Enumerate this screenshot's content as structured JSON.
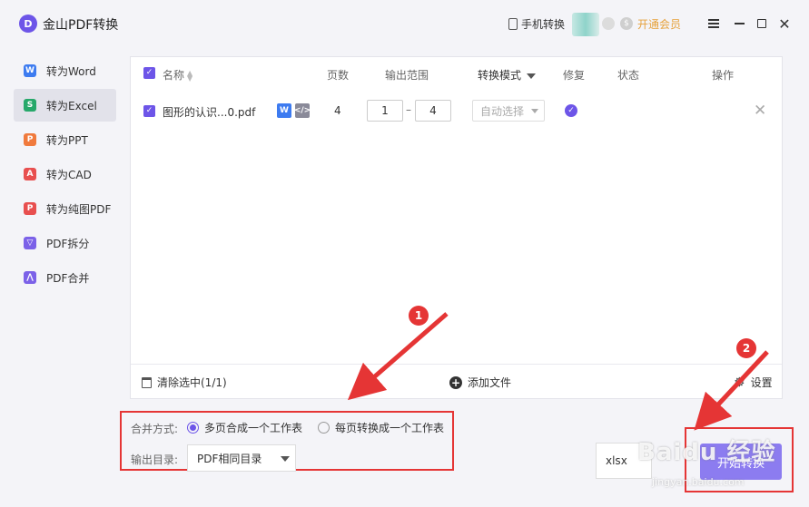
{
  "app": {
    "title": "金山PDF转换",
    "logo_glyph": "D",
    "phone_convert": "手机转换",
    "vip": "开通会员"
  },
  "sidebar": {
    "items": [
      {
        "label": "转为Word",
        "icon": "word-icon",
        "glyph": "W",
        "color": "#3d7bf0",
        "active": false
      },
      {
        "label": "转为Excel",
        "icon": "excel-icon",
        "glyph": "S",
        "color": "#27a86a",
        "active": true
      },
      {
        "label": "转为PPT",
        "icon": "ppt-icon",
        "glyph": "P",
        "color": "#f07a3d",
        "active": false
      },
      {
        "label": "转为CAD",
        "icon": "cad-icon",
        "glyph": "A",
        "color": "#e84f4f",
        "active": false
      },
      {
        "label": "转为纯图PDF",
        "icon": "image-pdf-icon",
        "glyph": "P",
        "color": "#e84f4f",
        "active": false
      },
      {
        "label": "PDF拆分",
        "icon": "split-icon",
        "glyph": "▽",
        "color": "#7b61e8",
        "active": false
      },
      {
        "label": "PDF合并",
        "icon": "merge-icon",
        "glyph": "⋀",
        "color": "#7b61e8",
        "active": false
      }
    ]
  },
  "table": {
    "headers": {
      "name": "名称",
      "pages": "页数",
      "range": "输出范围",
      "mode": "转换模式",
      "repair": "修复",
      "status": "状态",
      "action": "操作"
    },
    "rows": [
      {
        "file": "图形的认识...0.pdf",
        "pages": "4",
        "range_from": "1",
        "range_to": "4",
        "mode": "自动选择",
        "status": ""
      }
    ]
  },
  "footer": {
    "clear": "清除选中(1/1)",
    "add_file": "添加文件",
    "settings": "设置"
  },
  "options": {
    "merge_label": "合并方式:",
    "merge_option_1": "多页合成一个工作表",
    "merge_option_2": "每页转换成一个工作表",
    "merge_selected": 1,
    "output_label": "输出目录:",
    "output_dir": "PDF相同目录"
  },
  "format": {
    "value": "xlsx"
  },
  "start_button": "开始转换",
  "annotations": {
    "marker_1": "1",
    "marker_2": "2"
  },
  "watermark": {
    "text": "Baidu 经验",
    "sub": "jingyan.baidu.com"
  },
  "colors": {
    "accent": "#6d55e8",
    "annotation": "#e53535",
    "vip": "#e6a23c"
  }
}
